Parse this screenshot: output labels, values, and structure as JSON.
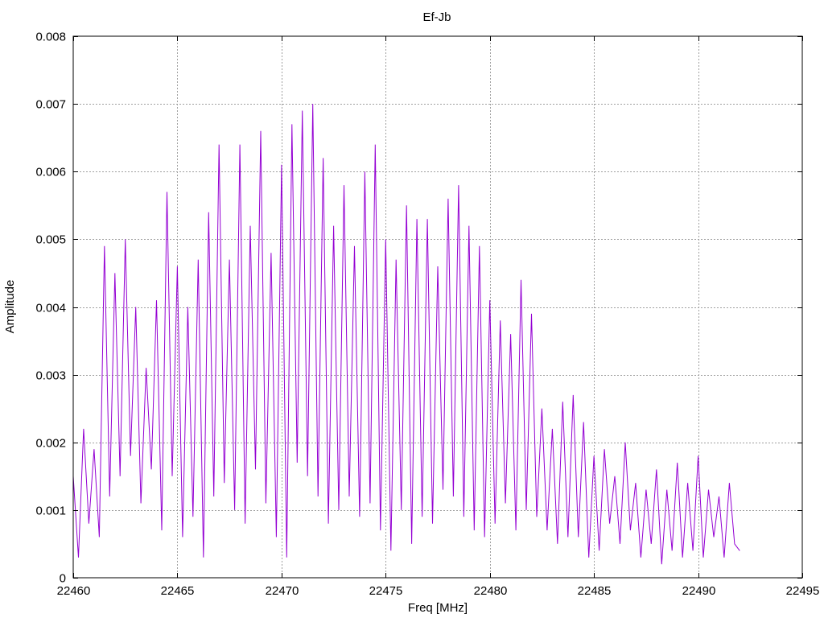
{
  "chart_data": {
    "type": "line",
    "title": "Ef-Jb",
    "xlabel": "Freq [MHz]",
    "ylabel": "Amplitude",
    "xlim": [
      22460,
      22495
    ],
    "ylim": [
      0,
      0.008
    ],
    "xticks": [
      22460,
      22465,
      22470,
      22475,
      22480,
      22485,
      22490,
      22495
    ],
    "yticks": [
      0,
      0.001,
      0.002,
      0.003,
      0.004,
      0.005,
      0.006,
      0.007,
      0.008
    ],
    "ytick_labels": [
      "0",
      "0.001",
      "0.002",
      "0.003",
      "0.004",
      "0.005",
      "0.006",
      "0.007",
      "0.008"
    ],
    "grid": true,
    "legend": "none",
    "series": [
      {
        "name": "Ef-Jb",
        "color": "#9400d3",
        "x_start": 22460,
        "x_step": 0.25,
        "values": [
          0.0015,
          0.0003,
          0.0022,
          0.0008,
          0.0019,
          0.0006,
          0.0049,
          0.0012,
          0.0045,
          0.0015,
          0.005,
          0.0018,
          0.004,
          0.0011,
          0.0031,
          0.0016,
          0.0041,
          0.0007,
          0.0057,
          0.0015,
          0.0046,
          0.0006,
          0.004,
          0.0009,
          0.0047,
          0.0003,
          0.0054,
          0.0012,
          0.0064,
          0.0014,
          0.0047,
          0.001,
          0.0064,
          0.0008,
          0.0052,
          0.0016,
          0.0066,
          0.0011,
          0.0048,
          0.0006,
          0.0061,
          0.0003,
          0.0067,
          0.0017,
          0.0069,
          0.0015,
          0.007,
          0.0012,
          0.0062,
          0.0008,
          0.0052,
          0.001,
          0.0058,
          0.0012,
          0.0049,
          0.0009,
          0.006,
          0.0011,
          0.0064,
          0.0007,
          0.005,
          0.0004,
          0.0047,
          0.001,
          0.0055,
          0.0005,
          0.0053,
          0.0009,
          0.0053,
          0.0008,
          0.0046,
          0.0013,
          0.0056,
          0.0012,
          0.0058,
          0.0009,
          0.0052,
          0.0007,
          0.0049,
          0.0006,
          0.0041,
          0.0008,
          0.0038,
          0.0011,
          0.0036,
          0.0007,
          0.0044,
          0.001,
          0.0039,
          0.0009,
          0.0025,
          0.0007,
          0.0022,
          0.0005,
          0.0026,
          0.0006,
          0.0027,
          0.0006,
          0.0023,
          0.0003,
          0.0018,
          0.0004,
          0.0019,
          0.0008,
          0.0015,
          0.0005,
          0.002,
          0.0007,
          0.0014,
          0.0003,
          0.0013,
          0.0005,
          0.0016,
          0.0002,
          0.0013,
          0.0004,
          0.0017,
          0.0003,
          0.0014,
          0.0004,
          0.0018,
          0.0003,
          0.0013,
          0.0006,
          0.0012,
          0.0003,
          0.0014,
          0.0005,
          0.0004
        ]
      }
    ]
  }
}
